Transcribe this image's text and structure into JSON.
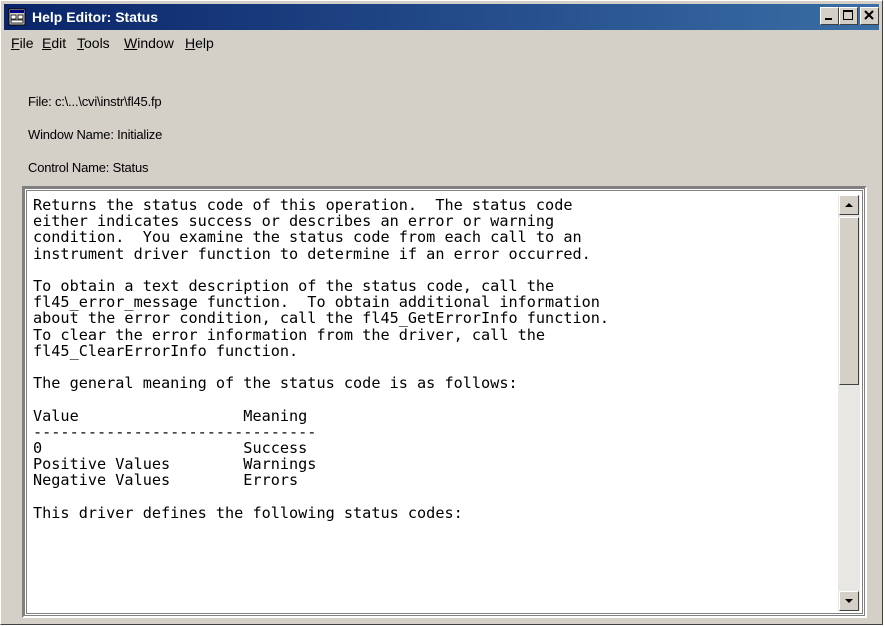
{
  "window": {
    "title": "Help Editor:  Status",
    "colors": {
      "titlebar": "#0a246a",
      "face": "#d4d0c8",
      "text_bg": "#ffffff"
    }
  },
  "title_buttons": {
    "minimize": "minimize-icon",
    "maximize": "maximize-icon",
    "close": "close-icon"
  },
  "menu": [
    "File",
    "Edit",
    "Tools",
    "Window",
    "Help"
  ],
  "info": {
    "file": "File:  c:\\...\\cvi\\instr\\fl45.fp",
    "window_name": "Window Name:  Initialize",
    "control_name": "Control Name:  Status"
  },
  "help_text": "Returns the status code of this operation.  The status code\neither indicates success or describes an error or warning\ncondition.  You examine the status code from each call to an\ninstrument driver function to determine if an error occurred.\n\nTo obtain a text description of the status code, call the\nfl45_error_message function.  To obtain additional information\nabout the error condition, call the fl45_GetErrorInfo function.\nTo clear the error information from the driver, call the\nfl45_ClearErrorInfo function.\n\nThe general meaning of the status code is as follows:\n\nValue                  Meaning\n-------------------------------\n0                      Success\nPositive Values        Warnings\nNegative Values        Errors\n\nThis driver defines the following status codes:",
  "scrollbar": {
    "position": 0
  }
}
